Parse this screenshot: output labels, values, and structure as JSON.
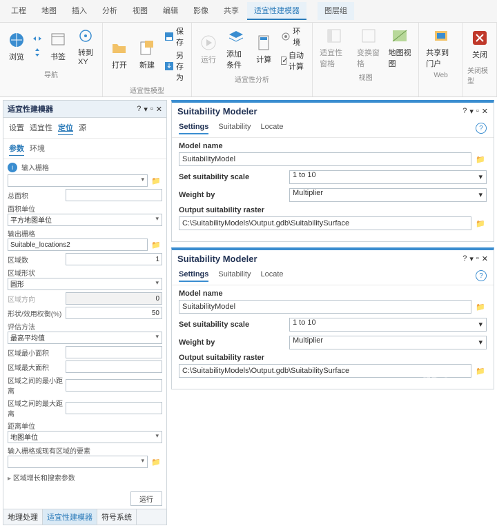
{
  "ribbon": {
    "tabs": [
      "工程",
      "地图",
      "插入",
      "分析",
      "视图",
      "编辑",
      "影像",
      "共享",
      "适宜性建模器",
      "图层组"
    ],
    "active": 8,
    "groups": {
      "nav": {
        "label": "导航",
        "browse": "浏览",
        "bookmark": "书签",
        "goxy": "转到\nXY"
      },
      "model": {
        "label": "适宜性模型",
        "open": "打开",
        "new": "新建",
        "save": "保存",
        "saveas": "另存为"
      },
      "analysis": {
        "label": "适宜性分析",
        "run": "运行",
        "addcrit": "添加条件",
        "compute": "计算",
        "env": "环境",
        "autocalc": "自动计算"
      },
      "view": {
        "label": "视图",
        "pane": "适宜性窗格",
        "trans": "变换窗格",
        "mapview": "地图视图"
      },
      "web": {
        "label": "Web",
        "share": "共享到门户"
      },
      "close": {
        "label": "关闭模型",
        "close": "关闭"
      }
    }
  },
  "left": {
    "title": "适宜性建模器",
    "tabs1": [
      "设置",
      "适宜性",
      "定位",
      "源"
    ],
    "tabs2": [
      "参数",
      "环境"
    ],
    "tabs1_active": 2,
    "tabs2_active": 0,
    "fields": {
      "input_raster": "输入栅格",
      "total_area": "总面积",
      "area_unit_label": "面积单位",
      "area_unit_val": "平方地图单位",
      "out_raster_label": "输出栅格",
      "out_raster_val": "Suitable_locations2",
      "region_count_label": "区域数",
      "region_count_val": "1",
      "region_shape_label": "区域形状",
      "region_shape_val": "圆形",
      "region_dir_label": "区域方向",
      "region_dir_val": "0",
      "shape_weight_label": "形状/效用权衡(%)",
      "shape_weight_val": "50",
      "eval_method_label": "评估方法",
      "eval_method_val": "最高平均值",
      "min_area_label": "区域最小面积",
      "max_area_label": "区域最大面积",
      "min_dist_label": "区域之间的最小距离",
      "max_dist_label": "区域之间的最大距离",
      "dist_unit_label": "距离单位",
      "dist_unit_val": "地图单位",
      "existing_label": "输入栅格或现有区域的要素",
      "expander": "区域增长和搜索参数",
      "run": "运行"
    },
    "footer": [
      "地理处理",
      "适宜性建模器",
      "符号系统"
    ],
    "footer_active": 1
  },
  "sm": {
    "title": "Suitability Modeler",
    "tabs": [
      "Settings",
      "Suitability",
      "Locate"
    ],
    "model_name_label": "Model name",
    "model_name_val": "SuitabilityModel",
    "scale_label": "Set suitability scale",
    "scale_val": "1 to 10",
    "weight_label": "Weight by",
    "weight_val": "Multiplier",
    "out_label": "Output suitability raster",
    "out_val": "C:\\SuitabilityModels\\Output.gdb\\SuitabilitySurface"
  },
  "watermark": "知乎 @summer"
}
